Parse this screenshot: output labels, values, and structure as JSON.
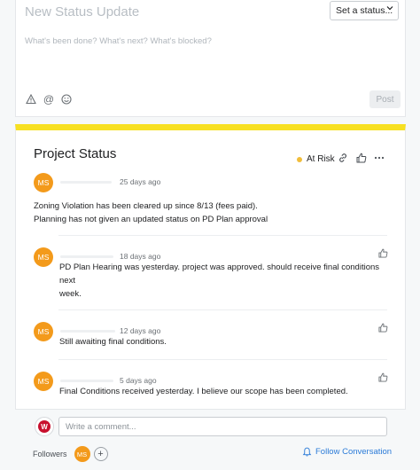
{
  "composer": {
    "title": "New Status Update",
    "status_select": "Set a status...",
    "placeholder": "What's been done? What's next? What's blocked?",
    "post_label": "Post"
  },
  "status": {
    "heading": "Project Status",
    "risk_label": "At Risk",
    "accent_color": "#f7e022",
    "risk_color": "#f1bd3a",
    "main_post": {
      "initials": "MS",
      "time": "25 days ago",
      "lines": [
        "Zoning Violation has been cleared up since 8/13 (fees paid).",
        "Planning has not given an updated status on PD Plan approval"
      ]
    },
    "comments": [
      {
        "initials": "MS",
        "time": "18 days ago",
        "lines": [
          "PD Plan Hearing was yesterday. project was approved. should receive final conditions next",
          "week."
        ]
      },
      {
        "initials": "MS",
        "time": "12 days ago",
        "lines": [
          "Still awaiting final conditions."
        ]
      },
      {
        "initials": "MS",
        "time": "5 days ago",
        "lines": [
          "Final Conditions received yesterday. I believe our scope has been completed."
        ]
      }
    ]
  },
  "comment_bar": {
    "placeholder": "Write a comment...",
    "followers_label": "Followers",
    "follower_initials": "MS",
    "follow_label": "Follow Conversation"
  },
  "icons": [
    "chevron-down-icon",
    "attachment-icon",
    "mention-icon",
    "emoji-icon",
    "link-icon",
    "thumbs-up-icon",
    "more-icon",
    "bell-icon",
    "plus-icon"
  ]
}
